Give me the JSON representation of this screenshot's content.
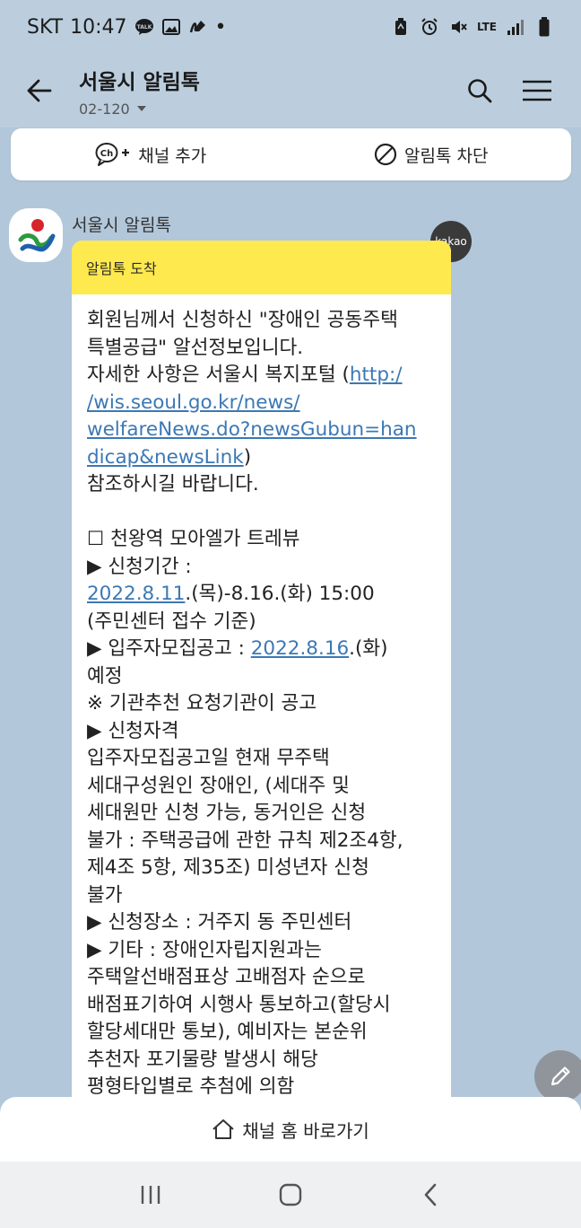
{
  "status_bar": {
    "carrier": "SKT",
    "time": "10:47",
    "talk_label": "TALK",
    "network": "LTE",
    "dot": "•"
  },
  "header": {
    "title": "서울시 알림톡",
    "subtitle": "02-120"
  },
  "channel_bar": {
    "add_label": "채널 추가",
    "add_icon_text": "Ch",
    "block_label": "알림톡 차단"
  },
  "message": {
    "sender": "서울시 알림톡",
    "badge": "kakao",
    "header": "알림톡 도착",
    "lines": [
      {
        "segments": [
          {
            "text": "회원님께서 신청하신 \"장애인 공동주택"
          }
        ]
      },
      {
        "segments": [
          {
            "text": "특별공급\" 알선정보입니다."
          }
        ]
      },
      {
        "segments": [
          {
            "text": "자세한 사항은 서울시 복지포털 ("
          },
          {
            "text": "http:/",
            "link": true
          }
        ]
      },
      {
        "segments": [
          {
            "text": "/wis.seoul.go.kr/news/",
            "link": true
          }
        ]
      },
      {
        "segments": [
          {
            "text": "welfareNews.do?newsGubun=han",
            "link": true
          }
        ]
      },
      {
        "segments": [
          {
            "text": "dicap&newsLink",
            "link": true
          },
          {
            "text": ")"
          }
        ]
      },
      {
        "segments": [
          {
            "text": "참조하시길 바랍니다."
          }
        ]
      },
      {
        "segments": []
      },
      {
        "segments": [
          {
            "text": "☐ 천왕역 모아엘가 트레뷰"
          }
        ]
      },
      {
        "segments": [
          {
            "text": "▶ 신청기간 :"
          }
        ]
      },
      {
        "segments": [
          {
            "text": "2022.8.11",
            "link": true
          },
          {
            "text": ".(목)-8.16.(화) 15:00"
          }
        ]
      },
      {
        "segments": [
          {
            "text": "(주민센터 접수 기준)"
          }
        ]
      },
      {
        "segments": [
          {
            "text": "▶ 입주자모집공고 : "
          },
          {
            "text": "2022.8.16",
            "link": true
          },
          {
            "text": ".(화)"
          }
        ]
      },
      {
        "segments": [
          {
            "text": "예정"
          }
        ]
      },
      {
        "segments": [
          {
            "text": "※ 기관추천 요청기관이 공고"
          }
        ]
      },
      {
        "segments": [
          {
            "text": "▶ 신청자격"
          }
        ]
      },
      {
        "segments": [
          {
            "text": "입주자모집공고일 현재 무주택"
          }
        ]
      },
      {
        "segments": [
          {
            "text": "세대구성원인 장애인, (세대주 및"
          }
        ]
      },
      {
        "segments": [
          {
            "text": "세대원만 신청 가능, 동거인은 신청"
          }
        ]
      },
      {
        "segments": [
          {
            "text": "불가 : 주택공급에 관한 규칙 제2조4항,"
          }
        ]
      },
      {
        "segments": [
          {
            "text": "제4조 5항, 제35조) 미성년자 신청"
          }
        ]
      },
      {
        "segments": [
          {
            "text": "불가"
          }
        ]
      },
      {
        "segments": [
          {
            "text": "▶ 신청장소 : 거주지 동 주민센터"
          }
        ]
      },
      {
        "segments": [
          {
            "text": "▶ 기타 : 장애인자립지원과는"
          }
        ]
      },
      {
        "segments": [
          {
            "text": "주택알선배점표상 고배점자 순으로"
          }
        ]
      },
      {
        "segments": [
          {
            "text": "배점표기하여 시행사 통보하고(할당시"
          }
        ]
      },
      {
        "segments": [
          {
            "text": "할당세대만 통보), 예비자는 본순위"
          }
        ]
      },
      {
        "segments": [
          {
            "text": "추천자 포기물량 발생시 해당"
          }
        ]
      },
      {
        "segments": [
          {
            "text": "평형타입별로 추첨에 의함"
          }
        ]
      }
    ]
  },
  "bottom": {
    "home_label": "채널 홈 바로가기"
  },
  "icons": {
    "back": "arrow-left-icon",
    "search": "search-icon",
    "menu": "hamburger-menu-icon",
    "add_channel": "chat-plus-icon",
    "block": "block-icon",
    "home": "house-icon",
    "edit": "pencil-icon",
    "nav_recent": "recent-apps-icon",
    "nav_home": "home-circle-icon",
    "nav_back": "chevron-left-icon"
  },
  "colors": {
    "background": "#b2c7da",
    "alert_header": "#fee94f",
    "link": "#3c78b4",
    "badge": "#3a3a3a"
  }
}
